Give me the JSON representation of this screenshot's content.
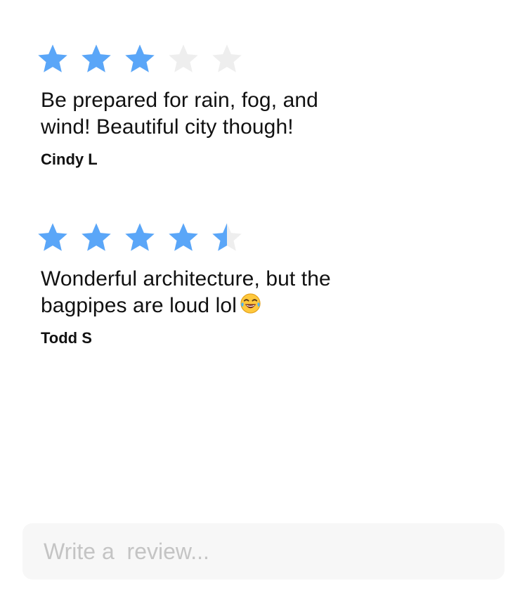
{
  "colors": {
    "star_filled": "#5aa6f8",
    "star_empty": "#eeeeee",
    "input_background": "#f7f7f7",
    "placeholder": "#c4c4c4"
  },
  "reviews": [
    {
      "rating": 3,
      "max_rating": 5,
      "line1": "Be prepared for rain, fog, and",
      "line2": "wind! Beautiful city though!",
      "author": "Cindy L"
    },
    {
      "rating": 4.5,
      "max_rating": 5,
      "line1": "Wonderful architecture, but the",
      "line2": "bagpipes are loud lol",
      "emoji": "face-with-tears-of-joy-icon",
      "author": "Todd S"
    }
  ],
  "composer": {
    "placeholder": "Write a  review...",
    "value": ""
  }
}
